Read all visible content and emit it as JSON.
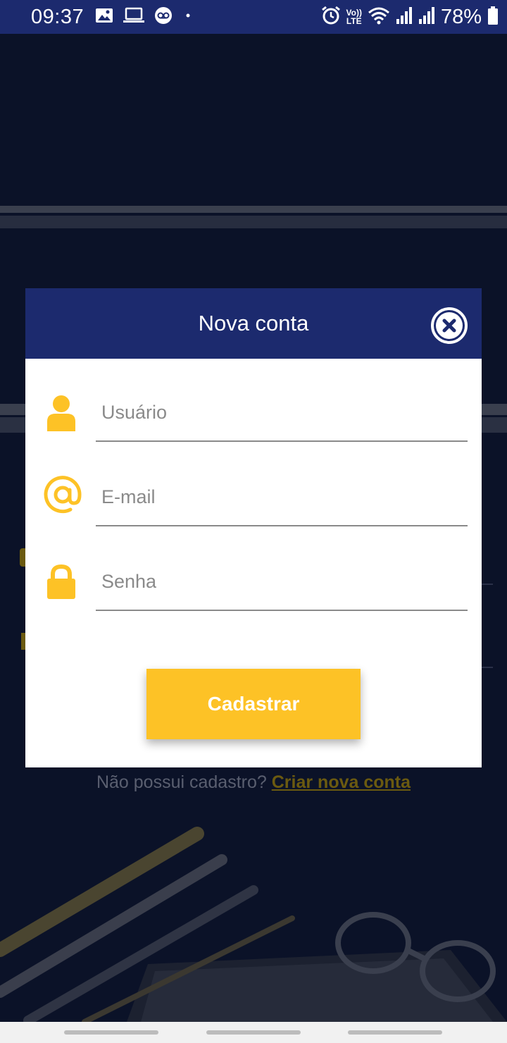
{
  "status_bar": {
    "time": "09:37",
    "battery": "78%",
    "left_icons": [
      "image-icon",
      "laptop-icon",
      "voicemail-icon",
      "dot-icon"
    ],
    "right_icons": [
      "alarm-icon",
      "volte-icon",
      "wifi-icon",
      "signal-icon",
      "signal-icon",
      "battery-icon"
    ],
    "volte_label_top": "Vo))",
    "volte_label_bottom": "LTE"
  },
  "modal": {
    "title": "Nova conta",
    "close_icon": "close-circle-icon",
    "fields": [
      {
        "icon": "user-icon",
        "placeholder": "Usuário",
        "value": ""
      },
      {
        "icon": "at-icon",
        "placeholder": "E-mail",
        "value": ""
      },
      {
        "icon": "lock-icon",
        "placeholder": "Senha",
        "value": ""
      }
    ],
    "submit_label": "Cadastrar"
  },
  "background": {
    "signup_prompt": "Não possui cadastro?",
    "signup_link": "Criar nova conta"
  },
  "colors": {
    "primary": "#1c2a6e",
    "accent": "#fdc226",
    "background": "#0b1228"
  }
}
